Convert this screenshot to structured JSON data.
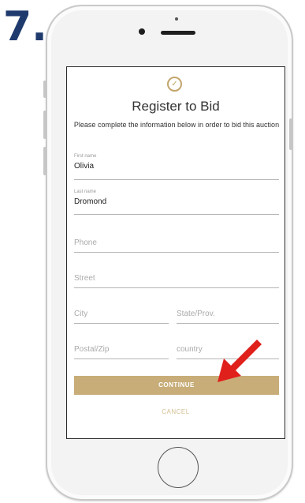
{
  "step_number": "7.",
  "screen": {
    "title": "Register to Bid",
    "subtitle": "Please complete the information below in order to bid this auction",
    "fields": {
      "first_name": {
        "label": "First name",
        "value": "Olivia"
      },
      "last_name": {
        "label": "Last name",
        "value": "Dromond"
      },
      "phone": {
        "placeholder": "Phone"
      },
      "street": {
        "placeholder": "Street"
      },
      "city": {
        "placeholder": "City"
      },
      "state": {
        "placeholder": "State/Prov."
      },
      "postal": {
        "placeholder": "Postal/Zip"
      },
      "country": {
        "placeholder": "country"
      }
    },
    "continue_label": "CONTINUE",
    "cancel_label": "CANCEL"
  },
  "colors": {
    "accent_gold": "#c8ad79",
    "arrow_red": "#e0201b",
    "step_blue": "#1f3b6e"
  },
  "icons": {
    "logo": "check-circle-icon",
    "annotation": "red-arrow-icon"
  }
}
